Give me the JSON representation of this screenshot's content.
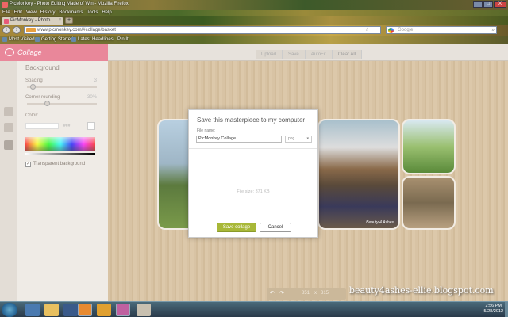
{
  "window": {
    "title": "PicMonkey - Photo Editing Made of Win - Mozilla Firefox",
    "controls": [
      "_",
      "□",
      "X"
    ]
  },
  "menu": [
    "File",
    "Edit",
    "View",
    "History",
    "Bookmarks",
    "Tools",
    "Help"
  ],
  "tabs": [
    {
      "label": "PicMonkey - Photo Editing Made of Win",
      "close": "x"
    }
  ],
  "new_tab": "+",
  "nav": {
    "back": "‹",
    "forward": "›",
    "url": "www.picmonkey.com/#collage/basket",
    "search_placeholder": "Google"
  },
  "bookmarks": [
    "Most Visited",
    "Getting Started",
    "Latest Headlines",
    "Pin It"
  ],
  "app": {
    "name": "Collage",
    "toolbar": [
      "Upload",
      "Save",
      "AutoFit",
      "Clear All"
    ]
  },
  "panel": {
    "heading": "Background",
    "spacing_label": "Spacing",
    "spacing_value": "3",
    "corner_label": "Corner rounding",
    "corner_value": "30%",
    "color_label": "Color:",
    "hex_label": "###",
    "transparent_label": "Transparent background",
    "transparent_checked": "✓",
    "spacing_level": 0.05,
    "corner_level": 0.3
  },
  "modal": {
    "title": "Save this masterpiece to my computer",
    "file_name_label": "File name:",
    "file_name_value": "PicMonkey Collage",
    "file_type": "png",
    "file_size": "File size: 371 KB",
    "save_label": "Save collage",
    "cancel_label": "Cancel"
  },
  "photo_watermark": "Beauty 4 Ashes",
  "zoom": {
    "width": "851",
    "x": "x",
    "height": "315"
  },
  "blog_text": "beauty4ashes-ellie.blogspot.com",
  "clock": {
    "time": "2:56 PM",
    "date": "5/28/2012"
  },
  "colors": {
    "accent": "#e9879a",
    "save_button": "#a8b838",
    "workspace": "#d8c3a4"
  }
}
